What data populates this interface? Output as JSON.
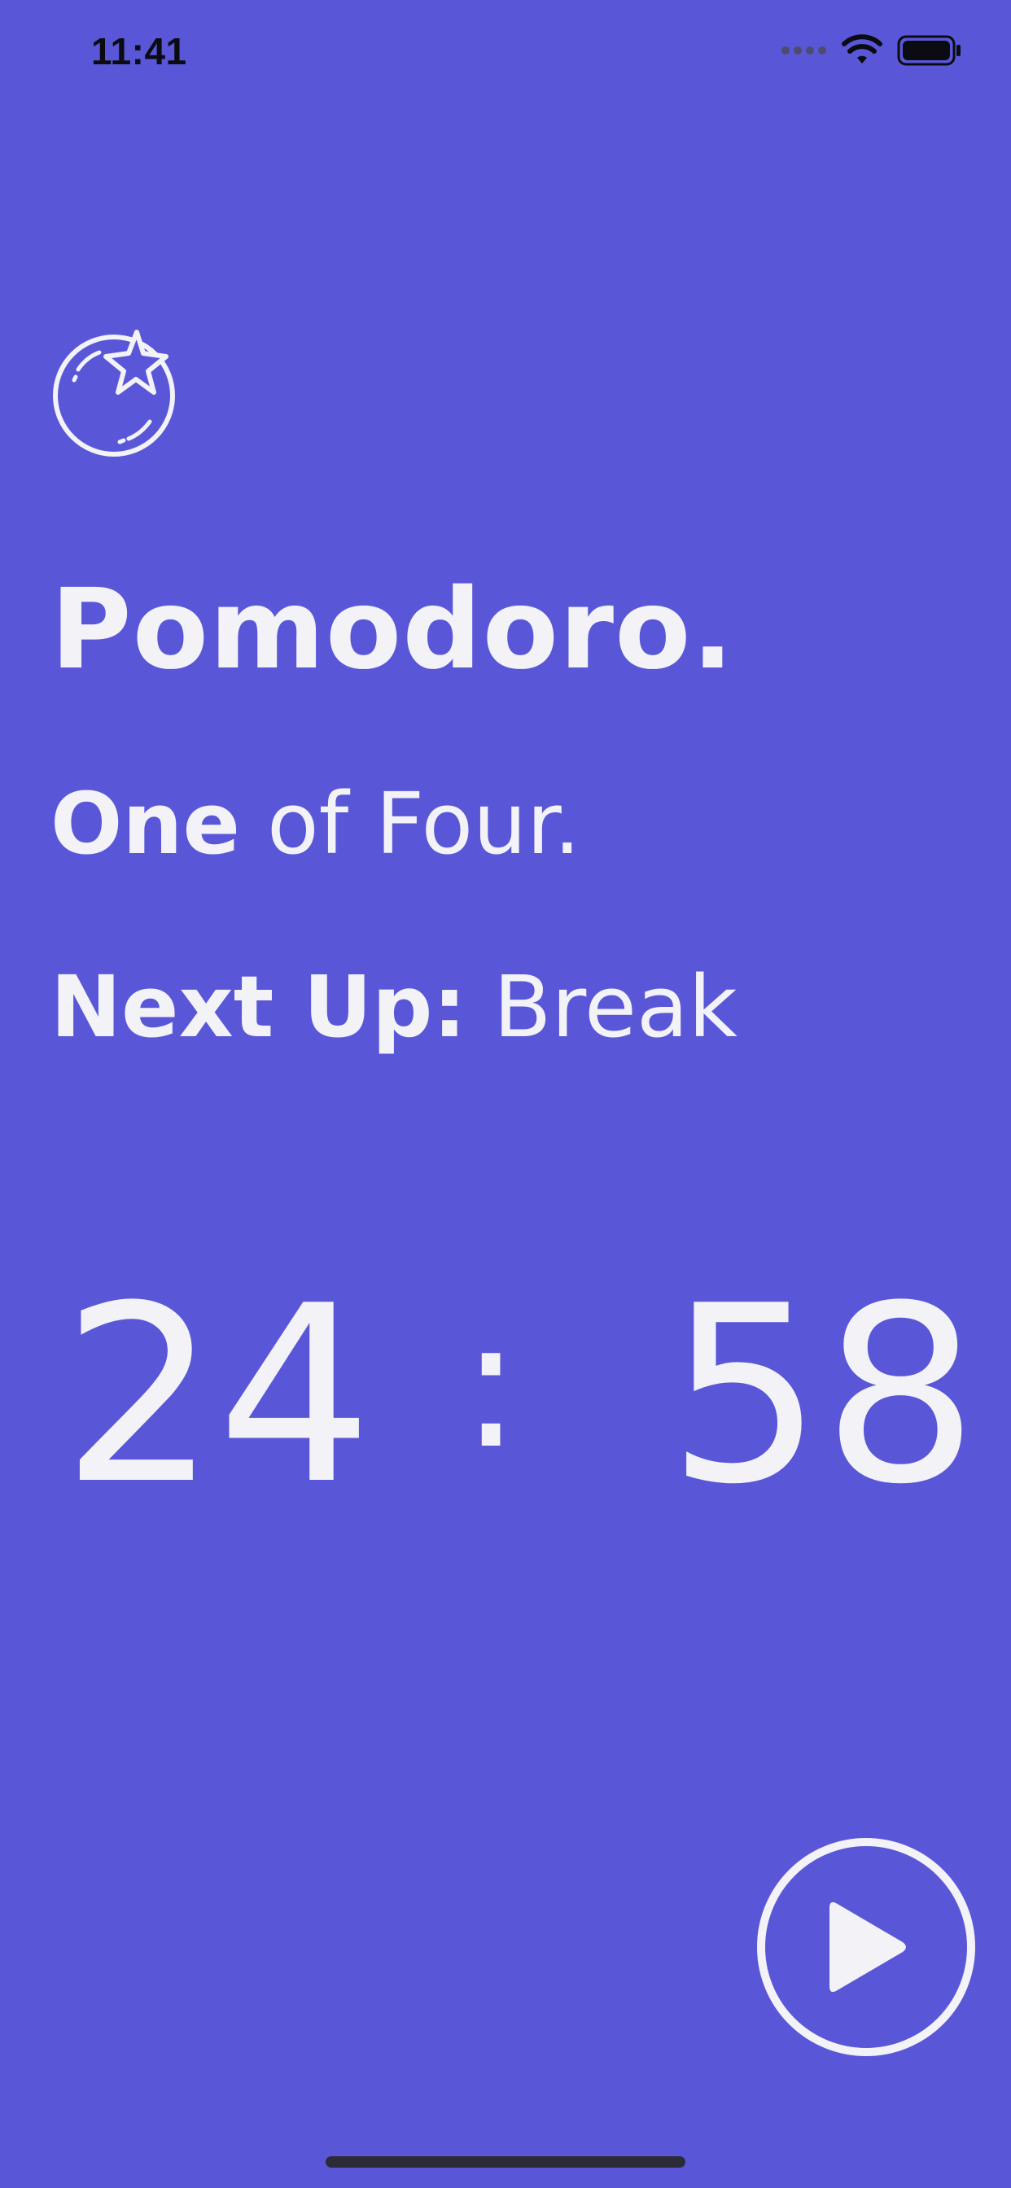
{
  "status_bar": {
    "time": "11:41",
    "signal_icon": "signal-dots-icon",
    "wifi_icon": "wifi-icon",
    "battery_icon": "battery-icon"
  },
  "app": {
    "icon": "tomato-icon",
    "title": "Pomodoro.",
    "round": {
      "current_label": "One",
      "total_label": "of Four."
    },
    "next_up": {
      "label": "Next Up:",
      "value": "Break"
    },
    "timer": {
      "minutes": "24",
      "separator": ":",
      "seconds": "58"
    },
    "play_button": {
      "icon": "play-icon"
    }
  },
  "colors": {
    "background": "#5957d8",
    "foreground": "#f2f2f7",
    "status_text": "#0b0b12",
    "home_indicator": "#2c2c38"
  }
}
